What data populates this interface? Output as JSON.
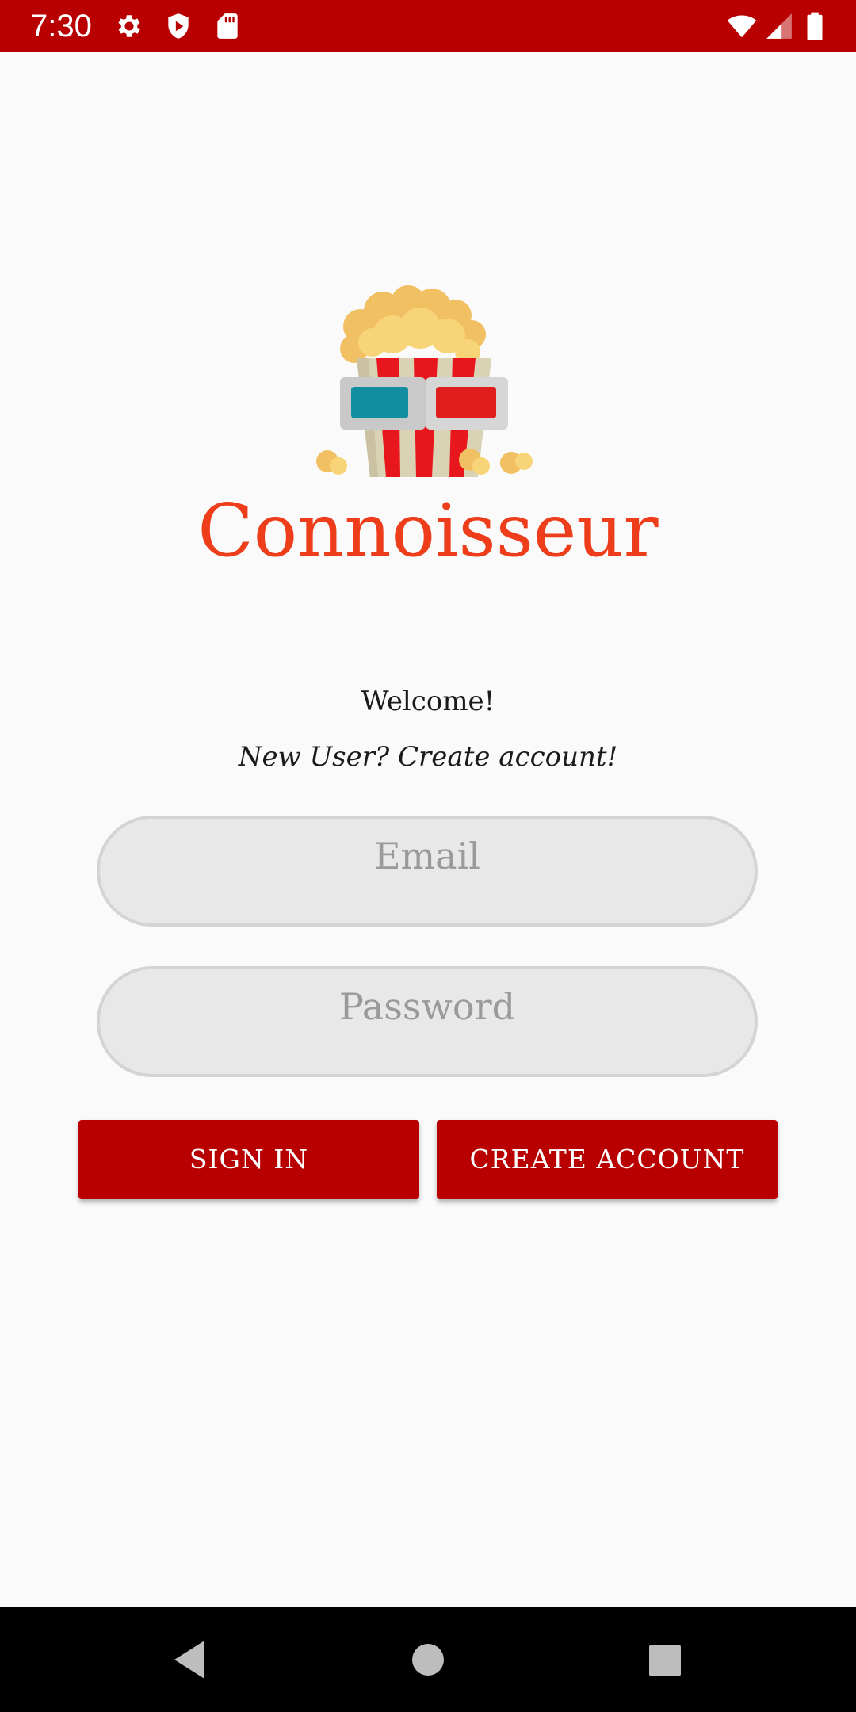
{
  "status_bar": {
    "time": "7:30",
    "background": "#b90000",
    "left_icons": [
      "gear-icon",
      "shield-icon",
      "sd-card-icon"
    ],
    "right_icons": [
      "wifi-icon",
      "cell-signal-icon",
      "battery-icon"
    ]
  },
  "app": {
    "title": "Connoisseur",
    "title_color": "#ee3d1a",
    "logo_icon": "popcorn-3d-glasses-icon"
  },
  "login": {
    "welcome": "Welcome!",
    "new_user_text": "New User? Create account!",
    "email_placeholder": "Email",
    "password_placeholder": "Password",
    "sign_in_label": "SIGN IN",
    "create_account_label": "CREATE ACCOUNT",
    "button_color": "#b90000"
  },
  "nav_bar": {
    "buttons": [
      "back-icon",
      "home-icon",
      "recents-icon"
    ]
  }
}
